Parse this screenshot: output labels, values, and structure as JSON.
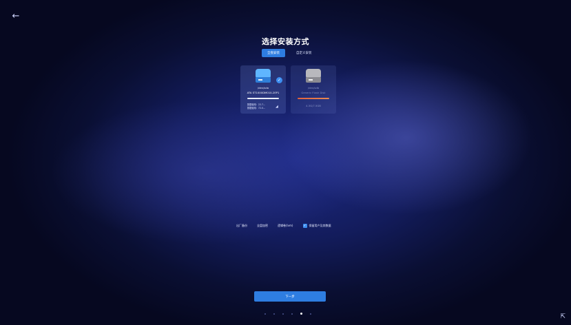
{
  "header": {
    "back_icon": "arrow-left-icon"
  },
  "title": "选择安装方式",
  "tabs": [
    {
      "label": "全盘安装",
      "active": true
    },
    {
      "label": "自定义安装",
      "active": false
    }
  ],
  "disks": [
    {
      "device": "/dev/sda",
      "model": "ATA ST1000DM010-2EP1",
      "usage_line1": "数据使用：22.7...",
      "usage_line2": "数据使用：72.0...",
      "selected": true
    },
    {
      "device": "/dev/sdb",
      "model": "Generic Flash Disk",
      "capacity": "4.3G/7.5GB",
      "selected": false
    }
  ],
  "options": {
    "factory_backup": "出厂备份",
    "full_encrypt": "全盘加密",
    "lvm": "逻辑卷(lvm)",
    "keep_user_data": "保留用户及其数据",
    "keep_user_data_checked": true
  },
  "next_button": "下一步",
  "pager": {
    "total": 6,
    "current": 5
  },
  "colors": {
    "accent": "#2e7de1",
    "warning": "#e2623c"
  }
}
